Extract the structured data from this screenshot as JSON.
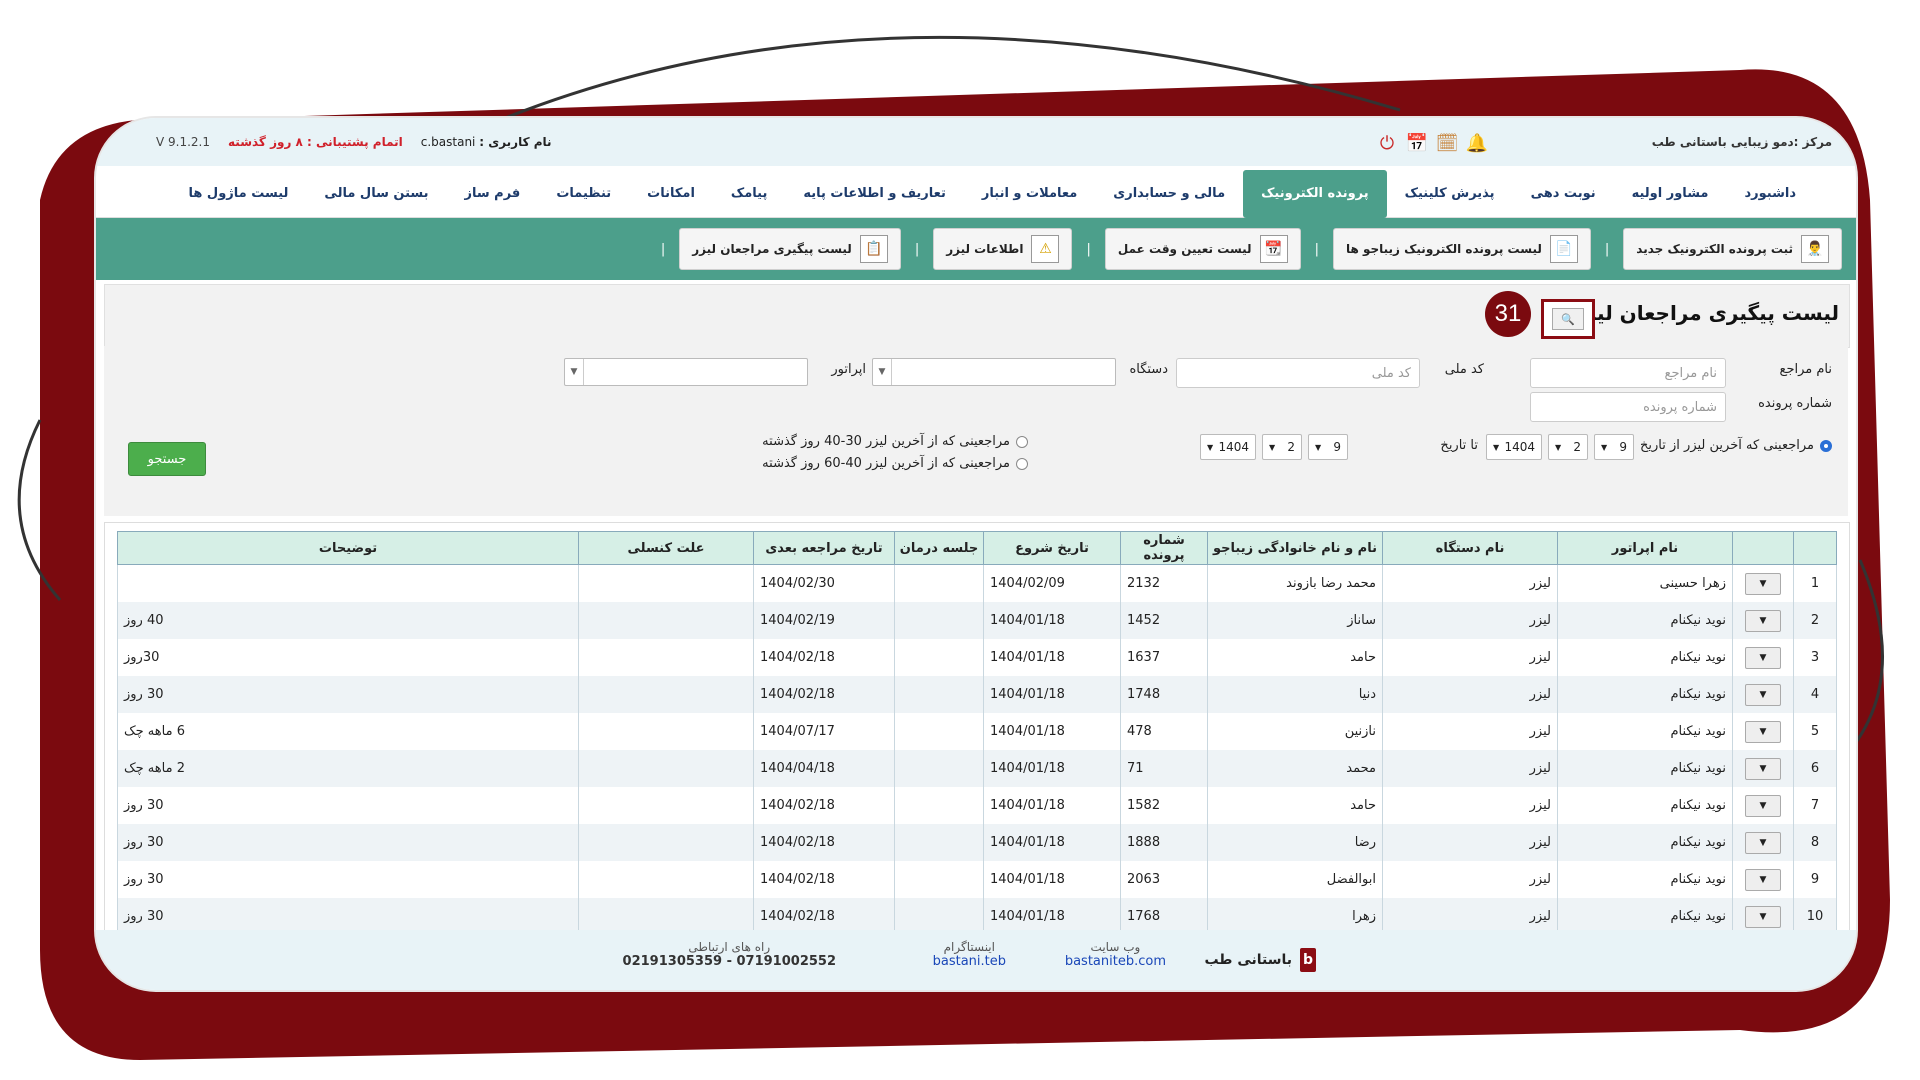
{
  "topbar": {
    "center_name": "مرکز :دمو زیبایی باستانی طب",
    "user_label": "نام کاربری :",
    "user_value": "c.bastani",
    "support": "اتمام پشتیبانی : ۸ روز گذشته",
    "version": "V 9.1.2.1"
  },
  "icons": [
    "bell-icon",
    "calendar-icon",
    "calendar-check-icon",
    "power-icon"
  ],
  "nav": [
    "داشبورد",
    "مشاور اولیه",
    "نوبت دهی",
    "پذیرش کلینیک",
    "پرونده الکترونیک",
    "مالی و حسابداری",
    "معاملات و انبار",
    "تعاریف و اطلاعات پایه",
    "پیامک",
    "امکانات",
    "تنظیمات",
    "فرم ساز",
    "بستن سال مالی",
    "لیست ماژول ها"
  ],
  "nav_active": "پرونده الکترونیک",
  "toolbar": [
    {
      "label": "ثبت پرونده الکترونیک جدید",
      "icon": "doctor-icon"
    },
    {
      "label": "لیست پرونده الکترونیک زیباجو ها",
      "icon": "file-list-icon"
    },
    {
      "label": "لیست تعیین وقت عمل",
      "icon": "calendar-doc-icon"
    },
    {
      "label": "اطلاعات لیزر",
      "icon": "laser-warning-icon"
    },
    {
      "label": "لیست پیگیری مراجعان لیزر",
      "icon": "clipboard-icon"
    }
  ],
  "page_title": "لیست پیگیری مراجعان لیزر",
  "step_badge": "31",
  "filters": {
    "patient_name_label": "نام مراجع",
    "patient_name_placeholder": "نام مراجع",
    "national_code_label": "کد ملی",
    "national_code_placeholder": "کد ملی",
    "device_label": "دستگاه",
    "operator_label": "اپراتور",
    "file_number_label": "شماره پرونده",
    "file_number_placeholder": "شماره پرونده",
    "radio_from_date": "مراجعینی که آخرین لیزر از تاریخ",
    "to_date": "تا تاریخ",
    "from_date": {
      "day": "9",
      "month": "2",
      "year": "1404"
    },
    "to_date_value": {
      "day": "9",
      "month": "2",
      "year": "1404"
    },
    "radio_30_40": "مراجعینی که از آخرین لیزر 30-40 روز گذشته",
    "radio_40_60": "مراجعینی که از آخرین لیزر 40-60 روز گذشته",
    "search_button": "جستجو"
  },
  "table": {
    "headers": [
      "",
      "",
      "نام اپراتور",
      "نام دستگاه",
      "نام و نام خانوادگی زیباجو",
      "شماره پرونده",
      "تاریخ شروع",
      "جلسه درمان",
      "تاریخ مراجعه بعدی",
      "علت کنسلی",
      "توضیحات"
    ],
    "rows": [
      [
        "1",
        "زهرا حسینی",
        "لیزر",
        "محمد رضا بازوند",
        "2132",
        "1404/02/09",
        "",
        "1404/02/30",
        "",
        ""
      ],
      [
        "2",
        "نوید نیکنام",
        "لیزر",
        "ساناز",
        "1452",
        "1404/01/18",
        "",
        "1404/02/19",
        "",
        "40 روز"
      ],
      [
        "3",
        "نوید نیکنام",
        "لیزر",
        "حامد",
        "1637",
        "1404/01/18",
        "",
        "1404/02/18",
        "",
        "30روز"
      ],
      [
        "4",
        "نوید نیکنام",
        "لیزر",
        "دنیا",
        "1748",
        "1404/01/18",
        "",
        "1404/02/18",
        "",
        "30 روز"
      ],
      [
        "5",
        "نوید نیکنام",
        "لیزر",
        "نازنین",
        "478",
        "1404/01/18",
        "",
        "1404/07/17",
        "",
        "6 ماهه چک"
      ],
      [
        "6",
        "نوید نیکنام",
        "لیزر",
        "محمد",
        "71",
        "1404/01/18",
        "",
        "1404/04/18",
        "",
        "2 ماهه چک"
      ],
      [
        "7",
        "نوید نیکنام",
        "لیزر",
        "حامد",
        "1582",
        "1404/01/18",
        "",
        "1404/02/18",
        "",
        "30 روز"
      ],
      [
        "8",
        "نوید نیکنام",
        "لیزر",
        "رضا",
        "1888",
        "1404/01/18",
        "",
        "1404/02/18",
        "",
        "30 روز"
      ],
      [
        "9",
        "نوید نیکنام",
        "لیزر",
        "ابوالفضل",
        "2063",
        "1404/01/18",
        "",
        "1404/02/18",
        "",
        "30 روز"
      ],
      [
        "10",
        "نوید نیکنام",
        "لیزر",
        "زهرا",
        "1768",
        "1404/01/18",
        "",
        "1404/02/18",
        "",
        "30 روز"
      ]
    ]
  },
  "footer": {
    "brand": "باستانی طب",
    "website_label": "وب سایت",
    "website": "bastaniteb.com",
    "instagram_label": "اینستاگرام",
    "instagram": "bastani.teb",
    "contact_label": "راه های ارتباطی",
    "contact": "07191002552 - 02191305359"
  },
  "colors": {
    "accent": "#4c9f8b",
    "frame": "#7b0a0f",
    "link": "#1a47b8",
    "support": "#d0202a"
  }
}
